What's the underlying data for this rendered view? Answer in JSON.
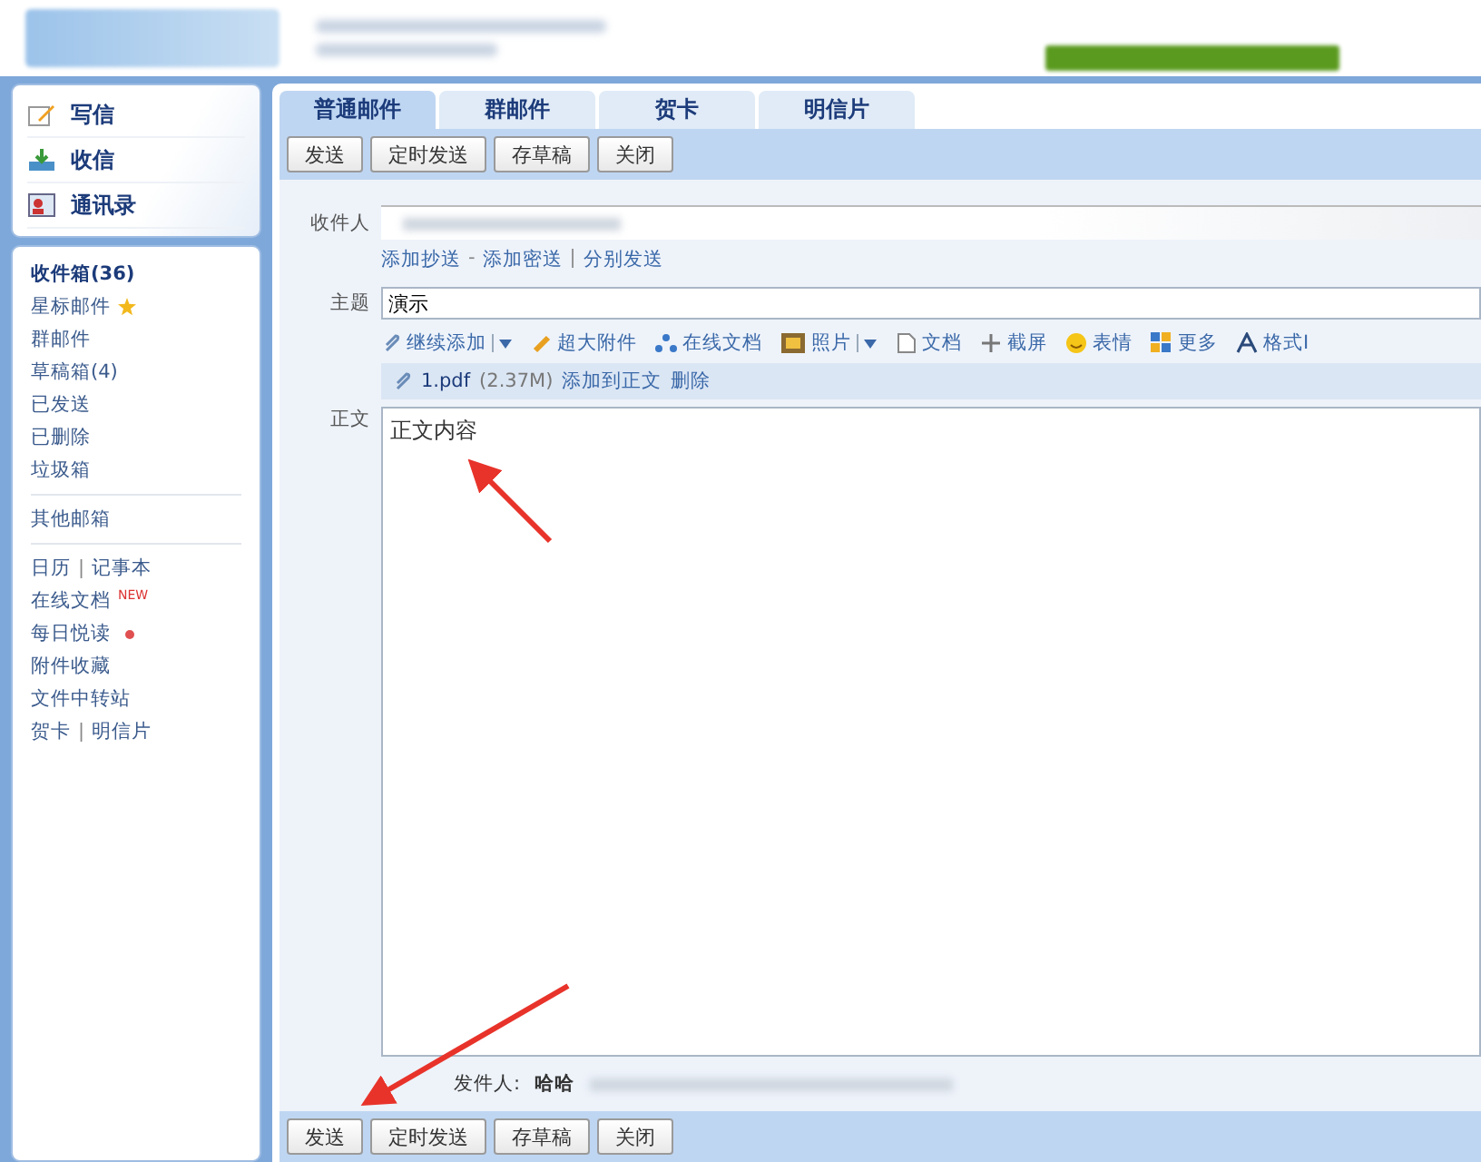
{
  "sidebar": {
    "actions": [
      {
        "kind": "write",
        "label": "写信"
      },
      {
        "kind": "receive",
        "label": "收信"
      },
      {
        "kind": "contacts",
        "label": "通讯录"
      }
    ],
    "folders": [
      {
        "label": "收件箱(36)",
        "selected": true
      },
      {
        "label": "星标邮件",
        "selected": false,
        "starred": true
      },
      {
        "label": "群邮件",
        "selected": false
      },
      {
        "label": "草稿箱(4)",
        "selected": false
      },
      {
        "label": "已发送",
        "selected": false
      },
      {
        "label": "已删除",
        "selected": false
      },
      {
        "label": "垃圾箱",
        "selected": false
      }
    ],
    "other": "其他邮箱",
    "tools": [
      {
        "labels": [
          "日历",
          "记事本"
        ],
        "separator": "|"
      },
      {
        "labels": [
          "在线文档"
        ],
        "badge": "NEW"
      },
      {
        "labels": [
          "每日悦读"
        ],
        "unread": true
      },
      {
        "labels": [
          "附件收藏"
        ]
      },
      {
        "labels": [
          "文件中转站"
        ]
      },
      {
        "labels": [
          "贺卡",
          "明信片"
        ],
        "separator": "|"
      }
    ]
  },
  "tabs": [
    {
      "label": "普通邮件",
      "selected": true
    },
    {
      "label": "群邮件",
      "selected": false
    },
    {
      "label": "贺卡",
      "selected": false
    },
    {
      "label": "明信片",
      "selected": false
    }
  ],
  "toolbar": [
    "发送",
    "定时发送",
    "存草稿",
    "关闭"
  ],
  "form": {
    "to_label": "收件人",
    "cc_links": [
      "添加抄送",
      "添加密送",
      "分别发送"
    ],
    "cc_separators": [
      "-",
      "|"
    ],
    "subject_label": "主题",
    "subject": "演示",
    "attach_tools": [
      {
        "kind": "clip",
        "label": "继续添加",
        "menu": true
      },
      {
        "kind": "bigclip",
        "label": "超大附件",
        "menu": false
      },
      {
        "kind": "doc-share",
        "label": "在线文档",
        "menu": false
      },
      {
        "kind": "photo",
        "label": "照片",
        "menu": true
      },
      {
        "kind": "page",
        "label": "文档",
        "menu": false
      },
      {
        "kind": "scissors",
        "label": "截屏",
        "menu": false
      },
      {
        "kind": "smile",
        "label": "表情",
        "menu": false
      },
      {
        "kind": "grid",
        "label": "更多",
        "menu": false
      },
      {
        "kind": "font",
        "label": "格式I",
        "menu": false
      }
    ],
    "attachment": {
      "name": "1.pdf",
      "size": "(2.37M)",
      "actions": [
        "添加到正文",
        "删除"
      ]
    },
    "body_label": "正文",
    "body": "正文内容",
    "sender_label": "发件人:",
    "sender_name": "哈哈"
  },
  "bottom_toolbar": [
    "发送",
    "定时发送",
    "存草稿",
    "关闭"
  ]
}
